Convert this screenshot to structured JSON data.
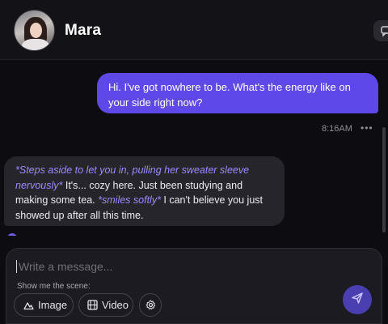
{
  "header": {
    "name": "Mara",
    "avatar_icon": "user-avatar-photo",
    "action_icon": "message-icon"
  },
  "messages": [
    {
      "role": "user",
      "text": "Hi. I've got nowhere to be. What's the energy like on your side right now?"
    },
    {
      "role": "meta",
      "time": "8:16AM",
      "more": "•••"
    },
    {
      "role": "character",
      "parts": {
        "action1": "*Steps aside to let you in, pulling her sweater sleeve nervously*",
        "speech1": " It's... cozy here. Just been studying and making some tea. ",
        "action2": "*smiles softly*",
        "speech2": " I can't believe you just showed up after all this time."
      }
    }
  ],
  "composer": {
    "placeholder": "Write a message...",
    "scene_label": "Show me the scene:",
    "chips": {
      "image": "Image",
      "video": "Video"
    },
    "icons": {
      "image": "landscape-icon",
      "video": "film-icon",
      "settings": "gear-icon",
      "send": "send-icon"
    }
  },
  "colors": {
    "background": "#0d0c10",
    "user_bubble": "#5f48e8",
    "bot_bubble": "#26252b",
    "action_text": "#9a8cff",
    "send_button": "#4a3fb0"
  }
}
